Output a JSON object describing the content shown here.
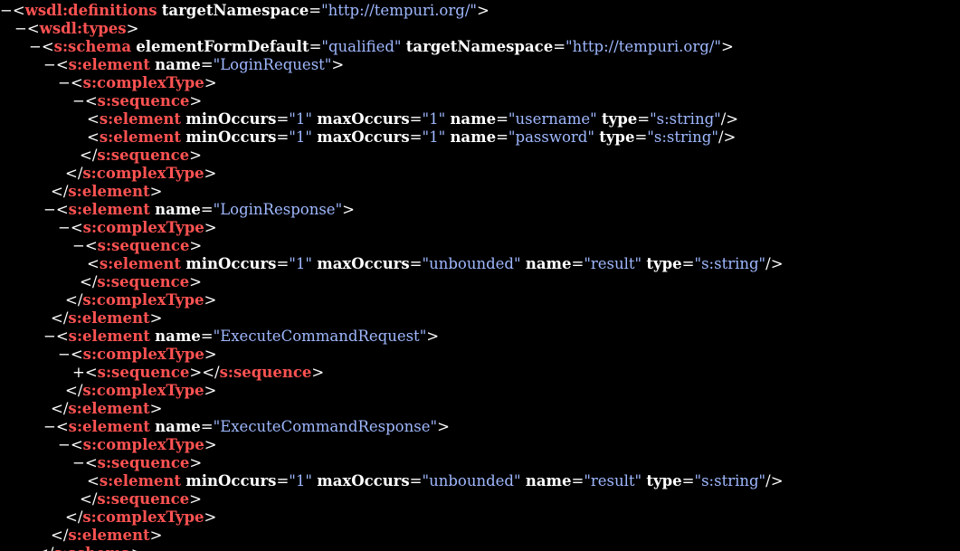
{
  "lines": [
    {
      "indent": 0,
      "toggle": "−",
      "parts": [
        [
          "punct",
          "<"
        ],
        [
          "tag",
          "wsdl:definitions"
        ],
        [
          "sp",
          " "
        ],
        [
          "attr",
          "targetNamespace"
        ],
        [
          "punct",
          "="
        ],
        [
          "val",
          "\"http://tempuri.org/\""
        ],
        [
          "punct",
          ">"
        ]
      ]
    },
    {
      "indent": 1,
      "toggle": "−",
      "parts": [
        [
          "punct",
          "<"
        ],
        [
          "tag",
          "wsdl:types"
        ],
        [
          "punct",
          ">"
        ]
      ]
    },
    {
      "indent": 2,
      "toggle": "−",
      "parts": [
        [
          "punct",
          "<"
        ],
        [
          "tag",
          "s:schema"
        ],
        [
          "sp",
          " "
        ],
        [
          "attr",
          "elementFormDefault"
        ],
        [
          "punct",
          "="
        ],
        [
          "val",
          "\"qualified\""
        ],
        [
          "sp",
          " "
        ],
        [
          "attr",
          "targetNamespace"
        ],
        [
          "punct",
          "="
        ],
        [
          "val",
          "\"http://tempuri.org/\""
        ],
        [
          "punct",
          ">"
        ]
      ]
    },
    {
      "indent": 3,
      "toggle": "−",
      "parts": [
        [
          "punct",
          "<"
        ],
        [
          "tag",
          "s:element"
        ],
        [
          "sp",
          " "
        ],
        [
          "attr",
          "name"
        ],
        [
          "punct",
          "="
        ],
        [
          "val",
          "\"LoginRequest\""
        ],
        [
          "punct",
          ">"
        ]
      ]
    },
    {
      "indent": 4,
      "toggle": "−",
      "parts": [
        [
          "punct",
          "<"
        ],
        [
          "tag",
          "s:complexType"
        ],
        [
          "punct",
          ">"
        ]
      ]
    },
    {
      "indent": 5,
      "toggle": "−",
      "parts": [
        [
          "punct",
          "<"
        ],
        [
          "tag",
          "s:sequence"
        ],
        [
          "punct",
          ">"
        ]
      ]
    },
    {
      "indent": 6,
      "toggle": "",
      "parts": [
        [
          "punct",
          "<"
        ],
        [
          "tag",
          "s:element"
        ],
        [
          "sp",
          " "
        ],
        [
          "attr",
          "minOccurs"
        ],
        [
          "punct",
          "="
        ],
        [
          "val",
          "\"1\""
        ],
        [
          "sp",
          " "
        ],
        [
          "attr",
          "maxOccurs"
        ],
        [
          "punct",
          "="
        ],
        [
          "val",
          "\"1\""
        ],
        [
          "sp",
          " "
        ],
        [
          "attr",
          "name"
        ],
        [
          "punct",
          "="
        ],
        [
          "val",
          "\"username\""
        ],
        [
          "sp",
          " "
        ],
        [
          "attr",
          "type"
        ],
        [
          "punct",
          "="
        ],
        [
          "val",
          "\"s:string\""
        ],
        [
          "punct",
          "/>"
        ]
      ]
    },
    {
      "indent": 6,
      "toggle": "",
      "parts": [
        [
          "punct",
          "<"
        ],
        [
          "tag",
          "s:element"
        ],
        [
          "sp",
          " "
        ],
        [
          "attr",
          "minOccurs"
        ],
        [
          "punct",
          "="
        ],
        [
          "val",
          "\"1\""
        ],
        [
          "sp",
          " "
        ],
        [
          "attr",
          "maxOccurs"
        ],
        [
          "punct",
          "="
        ],
        [
          "val",
          "\"1\""
        ],
        [
          "sp",
          " "
        ],
        [
          "attr",
          "name"
        ],
        [
          "punct",
          "="
        ],
        [
          "val",
          "\"password\""
        ],
        [
          "sp",
          " "
        ],
        [
          "attr",
          "type"
        ],
        [
          "punct",
          "="
        ],
        [
          "val",
          "\"s:string\""
        ],
        [
          "punct",
          "/>"
        ]
      ]
    },
    {
      "indent": 5.5,
      "toggle": "",
      "parts": [
        [
          "punct",
          "</"
        ],
        [
          "tag",
          "s:sequence"
        ],
        [
          "punct",
          ">"
        ]
      ]
    },
    {
      "indent": 4.5,
      "toggle": "",
      "parts": [
        [
          "punct",
          "</"
        ],
        [
          "tag",
          "s:complexType"
        ],
        [
          "punct",
          ">"
        ]
      ]
    },
    {
      "indent": 3.5,
      "toggle": "",
      "parts": [
        [
          "punct",
          "</"
        ],
        [
          "tag",
          "s:element"
        ],
        [
          "punct",
          ">"
        ]
      ]
    },
    {
      "indent": 3,
      "toggle": "−",
      "parts": [
        [
          "punct",
          "<"
        ],
        [
          "tag",
          "s:element"
        ],
        [
          "sp",
          " "
        ],
        [
          "attr",
          "name"
        ],
        [
          "punct",
          "="
        ],
        [
          "val",
          "\"LoginResponse\""
        ],
        [
          "punct",
          ">"
        ]
      ]
    },
    {
      "indent": 4,
      "toggle": "−",
      "parts": [
        [
          "punct",
          "<"
        ],
        [
          "tag",
          "s:complexType"
        ],
        [
          "punct",
          ">"
        ]
      ]
    },
    {
      "indent": 5,
      "toggle": "−",
      "parts": [
        [
          "punct",
          "<"
        ],
        [
          "tag",
          "s:sequence"
        ],
        [
          "punct",
          ">"
        ]
      ]
    },
    {
      "indent": 6,
      "toggle": "",
      "parts": [
        [
          "punct",
          "<"
        ],
        [
          "tag",
          "s:element"
        ],
        [
          "sp",
          " "
        ],
        [
          "attr",
          "minOccurs"
        ],
        [
          "punct",
          "="
        ],
        [
          "val",
          "\"1\""
        ],
        [
          "sp",
          " "
        ],
        [
          "attr",
          "maxOccurs"
        ],
        [
          "punct",
          "="
        ],
        [
          "val",
          "\"unbounded\""
        ],
        [
          "sp",
          " "
        ],
        [
          "attr",
          "name"
        ],
        [
          "punct",
          "="
        ],
        [
          "val",
          "\"result\""
        ],
        [
          "sp",
          " "
        ],
        [
          "attr",
          "type"
        ],
        [
          "punct",
          "="
        ],
        [
          "val",
          "\"s:string\""
        ],
        [
          "punct",
          "/>"
        ]
      ]
    },
    {
      "indent": 5.5,
      "toggle": "",
      "parts": [
        [
          "punct",
          "</"
        ],
        [
          "tag",
          "s:sequence"
        ],
        [
          "punct",
          ">"
        ]
      ]
    },
    {
      "indent": 4.5,
      "toggle": "",
      "parts": [
        [
          "punct",
          "</"
        ],
        [
          "tag",
          "s:complexType"
        ],
        [
          "punct",
          ">"
        ]
      ]
    },
    {
      "indent": 3.5,
      "toggle": "",
      "parts": [
        [
          "punct",
          "</"
        ],
        [
          "tag",
          "s:element"
        ],
        [
          "punct",
          ">"
        ]
      ]
    },
    {
      "indent": 3,
      "toggle": "−",
      "parts": [
        [
          "punct",
          "<"
        ],
        [
          "tag",
          "s:element"
        ],
        [
          "sp",
          " "
        ],
        [
          "attr",
          "name"
        ],
        [
          "punct",
          "="
        ],
        [
          "val",
          "\"ExecuteCommandRequest\""
        ],
        [
          "punct",
          ">"
        ]
      ]
    },
    {
      "indent": 4,
      "toggle": "−",
      "parts": [
        [
          "punct",
          "<"
        ],
        [
          "tag",
          "s:complexType"
        ],
        [
          "punct",
          ">"
        ]
      ]
    },
    {
      "indent": 5,
      "toggle": "+",
      "parts": [
        [
          "punct",
          "<"
        ],
        [
          "tag",
          "s:sequence"
        ],
        [
          "punct",
          "></"
        ],
        [
          "tag",
          "s:sequence"
        ],
        [
          "punct",
          ">"
        ]
      ]
    },
    {
      "indent": 4.5,
      "toggle": "",
      "parts": [
        [
          "punct",
          "</"
        ],
        [
          "tag",
          "s:complexType"
        ],
        [
          "punct",
          ">"
        ]
      ]
    },
    {
      "indent": 3.5,
      "toggle": "",
      "parts": [
        [
          "punct",
          "</"
        ],
        [
          "tag",
          "s:element"
        ],
        [
          "punct",
          ">"
        ]
      ]
    },
    {
      "indent": 3,
      "toggle": "−",
      "parts": [
        [
          "punct",
          "<"
        ],
        [
          "tag",
          "s:element"
        ],
        [
          "sp",
          " "
        ],
        [
          "attr",
          "name"
        ],
        [
          "punct",
          "="
        ],
        [
          "val",
          "\"ExecuteCommandResponse\""
        ],
        [
          "punct",
          ">"
        ]
      ]
    },
    {
      "indent": 4,
      "toggle": "−",
      "parts": [
        [
          "punct",
          "<"
        ],
        [
          "tag",
          "s:complexType"
        ],
        [
          "punct",
          ">"
        ]
      ]
    },
    {
      "indent": 5,
      "toggle": "−",
      "parts": [
        [
          "punct",
          "<"
        ],
        [
          "tag",
          "s:sequence"
        ],
        [
          "punct",
          ">"
        ]
      ]
    },
    {
      "indent": 6,
      "toggle": "",
      "parts": [
        [
          "punct",
          "<"
        ],
        [
          "tag",
          "s:element"
        ],
        [
          "sp",
          " "
        ],
        [
          "attr",
          "minOccurs"
        ],
        [
          "punct",
          "="
        ],
        [
          "val",
          "\"1\""
        ],
        [
          "sp",
          " "
        ],
        [
          "attr",
          "maxOccurs"
        ],
        [
          "punct",
          "="
        ],
        [
          "val",
          "\"unbounded\""
        ],
        [
          "sp",
          " "
        ],
        [
          "attr",
          "name"
        ],
        [
          "punct",
          "="
        ],
        [
          "val",
          "\"result\""
        ],
        [
          "sp",
          " "
        ],
        [
          "attr",
          "type"
        ],
        [
          "punct",
          "="
        ],
        [
          "val",
          "\"s:string\""
        ],
        [
          "punct",
          "/>"
        ]
      ]
    },
    {
      "indent": 5.5,
      "toggle": "",
      "parts": [
        [
          "punct",
          "</"
        ],
        [
          "tag",
          "s:sequence"
        ],
        [
          "punct",
          ">"
        ]
      ]
    },
    {
      "indent": 4.5,
      "toggle": "",
      "parts": [
        [
          "punct",
          "</"
        ],
        [
          "tag",
          "s:complexType"
        ],
        [
          "punct",
          ">"
        ]
      ]
    },
    {
      "indent": 3.5,
      "toggle": "",
      "parts": [
        [
          "punct",
          "</"
        ],
        [
          "tag",
          "s:element"
        ],
        [
          "punct",
          ">"
        ]
      ]
    },
    {
      "indent": 2.5,
      "toggle": "",
      "parts": [
        [
          "punct",
          "</"
        ],
        [
          "tag",
          "s:schema"
        ],
        [
          "punct",
          ">"
        ]
      ]
    }
  ],
  "colors": {
    "background": "#000000",
    "tag": "#ff5252",
    "attribute": "#ffffff",
    "value": "#9fb8ff",
    "punctuation": "#ffffff"
  }
}
